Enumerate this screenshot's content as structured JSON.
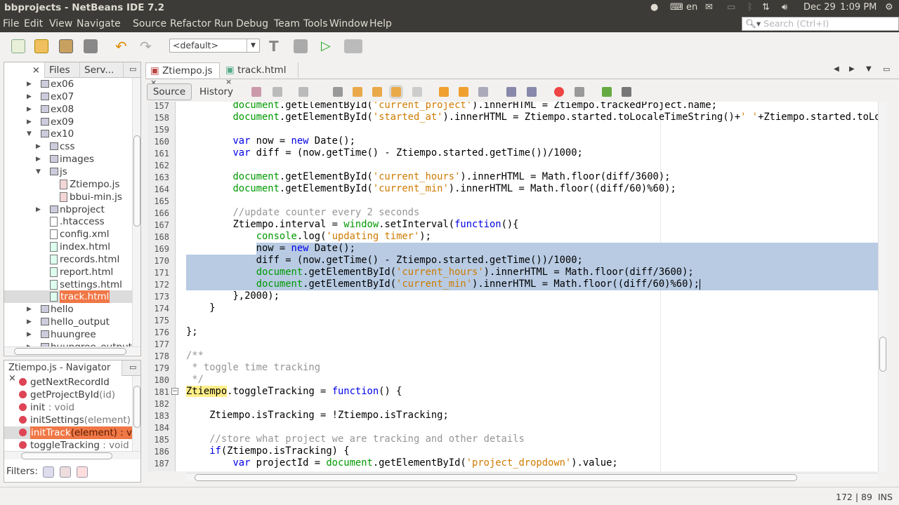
{
  "window": {
    "title": "bbprojects - NetBeans IDE 7.2"
  },
  "menu": [
    "File",
    "Edit",
    "View",
    "Navigate",
    "Source",
    "Refactor",
    "Run",
    "Debug",
    "Team",
    "Tools",
    "Window",
    "Help"
  ],
  "tray": {
    "lang": "en",
    "date": "Dec 29",
    "time": "1:09 PM",
    "icons": [
      "evernote-icon",
      "keyboard-icon",
      "mail-icon",
      "battery-icon",
      "bluetooth-icon",
      "network-icon",
      "volume-icon",
      "power-icon"
    ]
  },
  "search": {
    "placeholder": "Search (Ctrl+I)"
  },
  "toolbar": {
    "config": "<default>",
    "icons": [
      "new-file-icon",
      "new-project-icon",
      "open-project-icon",
      "close-project-icon",
      "undo-icon",
      "redo-icon",
      "build-icon",
      "clean-build-icon",
      "run-icon",
      "debug-icon"
    ]
  },
  "projects_panel": {
    "tabs": [
      "Files",
      "Serv..."
    ],
    "tree": [
      {
        "label": "ex06",
        "level": 0,
        "type": "folder",
        "exp": "closed"
      },
      {
        "label": "ex07",
        "level": 0,
        "type": "folder",
        "exp": "closed"
      },
      {
        "label": "ex08",
        "level": 0,
        "type": "folder",
        "exp": "closed"
      },
      {
        "label": "ex09",
        "level": 0,
        "type": "folder",
        "exp": "closed"
      },
      {
        "label": "ex10",
        "level": 0,
        "type": "folder",
        "exp": "open"
      },
      {
        "label": "css",
        "level": 1,
        "type": "folder",
        "exp": "closed"
      },
      {
        "label": "images",
        "level": 1,
        "type": "folder",
        "exp": "closed"
      },
      {
        "label": "js",
        "level": 1,
        "type": "folder",
        "exp": "open"
      },
      {
        "label": "Ztiempo.js",
        "level": 2,
        "type": "js"
      },
      {
        "label": "bbui-min.js",
        "level": 2,
        "type": "js"
      },
      {
        "label": "nbproject",
        "level": 1,
        "type": "folder",
        "exp": "closed"
      },
      {
        "label": ".htaccess",
        "level": 1,
        "type": "file"
      },
      {
        "label": "config.xml",
        "level": 1,
        "type": "file"
      },
      {
        "label": "index.html",
        "level": 1,
        "type": "html"
      },
      {
        "label": "records.html",
        "level": 1,
        "type": "html"
      },
      {
        "label": "report.html",
        "level": 1,
        "type": "html"
      },
      {
        "label": "settings.html",
        "level": 1,
        "type": "html"
      },
      {
        "label": "track.html",
        "level": 1,
        "type": "html",
        "selected": true
      },
      {
        "label": "hello",
        "level": 0,
        "type": "folder",
        "exp": "closed"
      },
      {
        "label": "hello_output",
        "level": 0,
        "type": "folder",
        "exp": "closed"
      },
      {
        "label": "huungree",
        "level": 0,
        "type": "folder",
        "exp": "closed"
      },
      {
        "label": "huungree_output",
        "level": 0,
        "type": "folder",
        "exp": "closed"
      }
    ]
  },
  "navigator": {
    "title": "Ztiempo.js - Navigator",
    "items": [
      {
        "name": "getNextRecordId",
        "sig": ""
      },
      {
        "name": "getProjectById",
        "sig": "(id)"
      },
      {
        "name": "init",
        "sig": " : void"
      },
      {
        "name": "initSettings",
        "sig": "(element) :"
      },
      {
        "name": "initTrack",
        "sig": "(element) : void",
        "selected": true
      },
      {
        "name": "toggleTracking",
        "sig": " : void"
      }
    ],
    "filters_label": "Filters:"
  },
  "editor": {
    "tabs": [
      {
        "label": "Ztiempo.js",
        "active": true
      },
      {
        "label": "track.html"
      }
    ],
    "views": [
      "Source",
      "History"
    ],
    "first_line": 157,
    "selection": {
      "from_line": 169,
      "from_col": 13,
      "to_line": 172
    },
    "lines": [
      [
        [
          "n",
          "        "
        ],
        [
          "g",
          "document"
        ],
        [
          "n",
          ".getElementById("
        ],
        [
          "s",
          "'current_project'"
        ],
        [
          "n",
          ").innerHTML = Ztiempo.trackedProject.name;"
        ]
      ],
      [
        [
          "n",
          "        "
        ],
        [
          "g",
          "document"
        ],
        [
          "n",
          ".getElementById("
        ],
        [
          "s",
          "'started_at'"
        ],
        [
          "n",
          ").innerHTML = Ztiempo.started.toLocaleTimeString()+"
        ],
        [
          "s",
          "' '"
        ],
        [
          "n",
          "+Ztiempo.started.toLocaleDateString();"
        ]
      ],
      [],
      [
        [
          "n",
          "        "
        ],
        [
          "k",
          "var"
        ],
        [
          "n",
          " now = "
        ],
        [
          "k",
          "new"
        ],
        [
          "n",
          " Date();"
        ]
      ],
      [
        [
          "n",
          "        "
        ],
        [
          "k",
          "var"
        ],
        [
          "n",
          " diff = (now.getTime() - Ztiempo.started.getTime())/1000;"
        ]
      ],
      [],
      [
        [
          "n",
          "        "
        ],
        [
          "g",
          "document"
        ],
        [
          "n",
          ".getElementById("
        ],
        [
          "s",
          "'current_hours'"
        ],
        [
          "n",
          ").innerHTML = Math.floor(diff/3600);"
        ]
      ],
      [
        [
          "n",
          "        "
        ],
        [
          "g",
          "document"
        ],
        [
          "n",
          ".getElementById("
        ],
        [
          "s",
          "'current_min'"
        ],
        [
          "n",
          ").innerHTML = Math.floor((diff/60)%60);"
        ]
      ],
      [],
      [
        [
          "n",
          "        "
        ],
        [
          "c",
          "//update counter every 2 seconds"
        ]
      ],
      [
        [
          "n",
          "        Ztiempo.interval = "
        ],
        [
          "g",
          "window"
        ],
        [
          "n",
          ".setInterval("
        ],
        [
          "k",
          "function"
        ],
        [
          "n",
          "(){"
        ]
      ],
      [
        [
          "n",
          "            "
        ],
        [
          "g",
          "console"
        ],
        [
          "n",
          ".log("
        ],
        [
          "s",
          "'updating timer'"
        ],
        [
          "n",
          ");"
        ]
      ],
      [
        [
          "n",
          "            now = "
        ],
        [
          "k",
          "new"
        ],
        [
          "n",
          " Date();"
        ]
      ],
      [
        [
          "n",
          "            diff = (now.getTime() - Ztiempo.started.getTime())/1000;"
        ]
      ],
      [
        [
          "n",
          "            "
        ],
        [
          "g",
          "document"
        ],
        [
          "n",
          ".getElementById("
        ],
        [
          "s",
          "'current_hours'"
        ],
        [
          "n",
          ").innerHTML = Math.floor(diff/3600);"
        ]
      ],
      [
        [
          "n",
          "            "
        ],
        [
          "g",
          "document"
        ],
        [
          "n",
          ".getElementById("
        ],
        [
          "s",
          "'current_min'"
        ],
        [
          "n",
          ").innerHTML = Math.floor((diff/60)%60);"
        ]
      ],
      [
        [
          "n",
          "        },2000);"
        ]
      ],
      [
        [
          "n",
          "    }"
        ]
      ],
      [],
      [
        [
          "n",
          "};"
        ]
      ],
      [],
      [
        [
          "c",
          "/**"
        ]
      ],
      [
        [
          "c",
          " * toggle time tracking"
        ]
      ],
      [
        [
          "c",
          " */"
        ]
      ],
      [
        [
          "h",
          "Ztiempo"
        ],
        [
          "n",
          ".toggleTracking = "
        ],
        [
          "k",
          "function"
        ],
        [
          "n",
          "() {"
        ]
      ],
      [],
      [
        [
          "n",
          "    Ztiempo.isTracking = !Ztiempo.isTracking;"
        ]
      ],
      [],
      [
        [
          "n",
          "    "
        ],
        [
          "c",
          "//store what project we are tracking and other details"
        ]
      ],
      [
        [
          "n",
          "    "
        ],
        [
          "k",
          "if"
        ],
        [
          "n",
          "(Ztiempo.isTracking) {"
        ]
      ],
      [
        [
          "n",
          "        "
        ],
        [
          "k",
          "var"
        ],
        [
          "n",
          " projectId = "
        ],
        [
          "g",
          "document"
        ],
        [
          "n",
          ".getElementById("
        ],
        [
          "s",
          "'project_dropdown'"
        ],
        [
          "n",
          ").value;"
        ]
      ],
      []
    ]
  },
  "status": {
    "position": "172 | 89",
    "mode": "INS"
  }
}
